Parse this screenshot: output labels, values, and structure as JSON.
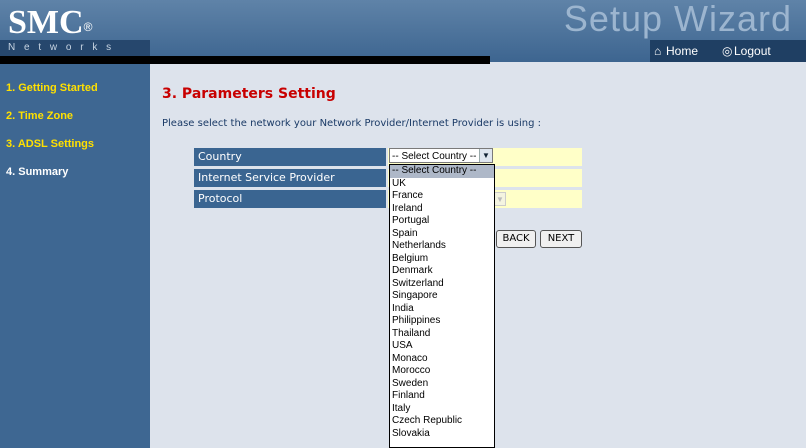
{
  "header": {
    "logo": "SMC",
    "logo_mark": "®",
    "subtitle": "N e t w o r k s",
    "wizard_title": "Setup Wizard",
    "nav": {
      "home_label": "Home",
      "logout_label": "Logout"
    }
  },
  "sidebar": {
    "items": [
      {
        "label": "1. Getting Started",
        "color": "#ffe000"
      },
      {
        "label": "2. Time Zone",
        "color": "#ffe000"
      },
      {
        "label": "3. ADSL Settings",
        "color": "#ffe000"
      },
      {
        "label": "4. Summary",
        "color": "#ffffff"
      }
    ]
  },
  "main": {
    "title": "3. Parameters Setting",
    "instruction": "Please select the network your Network Provider/Internet Provider is using :",
    "fields": [
      {
        "label": "Country"
      },
      {
        "label": "Internet Service Provider"
      },
      {
        "label": "Protocol"
      }
    ],
    "country_select": {
      "selected": "-- Select Country --"
    },
    "buttons": {
      "back": "BACK",
      "next": "NEXT"
    },
    "dropdown_options": [
      "-- Select Country --",
      "UK",
      "France",
      "Ireland",
      "Portugal",
      "Spain",
      "Netherlands",
      "Belgium",
      "Denmark",
      "Switzerland",
      "Singapore",
      "India",
      "Philippines",
      "Thailand",
      "USA",
      "Monaco",
      "Morocco",
      "Sweden",
      "Finland",
      "Italy",
      "Czech Republic",
      "Slovakia"
    ]
  },
  "colors": {
    "sidebar": "#3e6792",
    "title": "#c80000",
    "label_bg": "#3a6591",
    "value_bg": "#ffffc8"
  }
}
